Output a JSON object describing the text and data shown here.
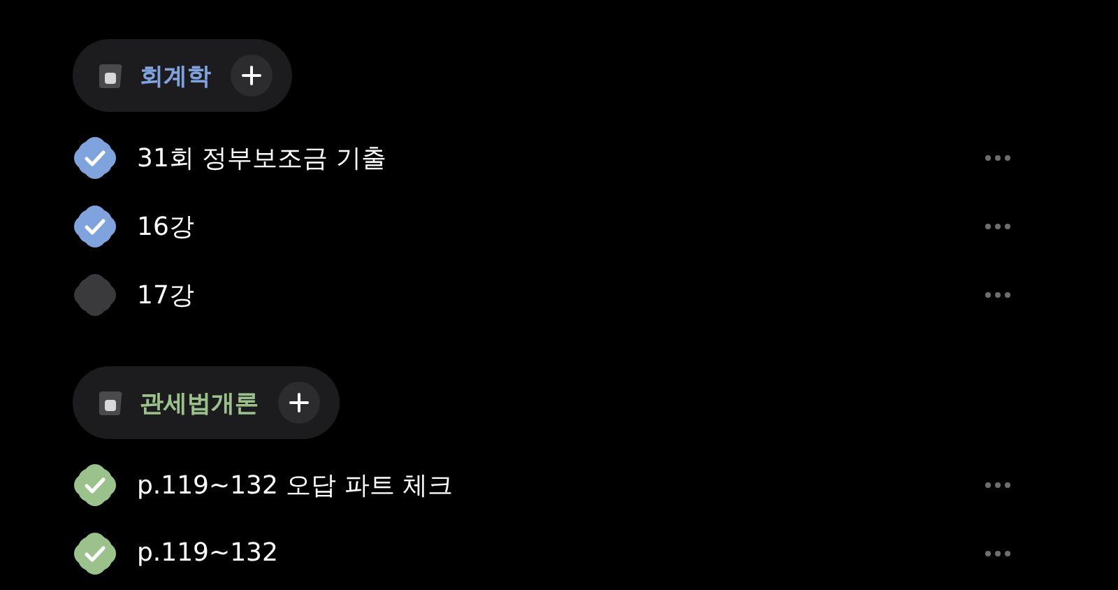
{
  "groups": [
    {
      "title": "회계학",
      "color": "#7ea3dd",
      "tasks": [
        {
          "label": "31회 정부보조금 기출",
          "checked": true
        },
        {
          "label": "16강",
          "checked": true
        },
        {
          "label": "17강",
          "checked": false
        }
      ]
    },
    {
      "title": "관세법개론",
      "color": "#9cc28c",
      "tasks": [
        {
          "label": "p.119~132 오답 파트 체크",
          "checked": true
        },
        {
          "label": "p.119~132",
          "checked": true
        }
      ]
    }
  ]
}
